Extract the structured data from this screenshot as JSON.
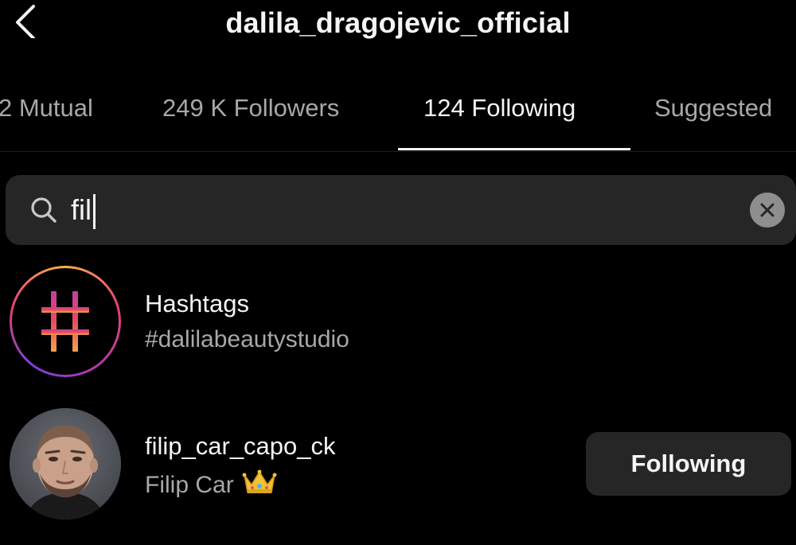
{
  "header": {
    "title": "dalila_dragojevic_official",
    "back_icon": "chevron-left-icon"
  },
  "tabs": [
    {
      "label": "2 Mutual",
      "active": false
    },
    {
      "label": "249 K Followers",
      "active": false
    },
    {
      "label": "124 Following",
      "active": true
    },
    {
      "label": "Suggested",
      "active": false
    }
  ],
  "search": {
    "value": "fil",
    "icon": "search-icon",
    "clear_icon": "clear-icon"
  },
  "results": [
    {
      "type": "hashtag",
      "title": "Hashtags",
      "subtitle": "#dalilabeautystudio",
      "icon": "hashtag-icon"
    },
    {
      "type": "user",
      "username": "filip_car_capo_ck",
      "full_name": "Filip Car",
      "emoji_icon": "crown-icon",
      "button_label": "Following"
    }
  ],
  "colors": {
    "background": "#000000",
    "primary_text": "#f5f5f5",
    "secondary_text": "#a8a8a8",
    "surface": "#262626"
  }
}
